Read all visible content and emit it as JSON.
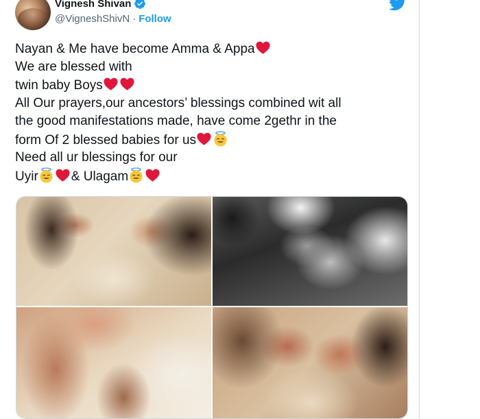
{
  "author": {
    "display_name": "Vignesh Shivan",
    "handle": "@VigneshShivN",
    "separator": "·",
    "follow_label": "Follow"
  },
  "tweet": {
    "lines": [
      [
        {
          "t": "Nayan & Me have become Amma & Appa"
        },
        {
          "e": "red-heart"
        }
      ],
      [
        {
          "t": "We are blessed with"
        }
      ],
      [
        {
          "t": "twin baby Boys"
        },
        {
          "e": "red-heart"
        },
        {
          "e": "red-heart"
        }
      ],
      [
        {
          "t": "All Our prayers,our ancestors’ blessings combined wit all"
        }
      ],
      [
        {
          "t": "the good manifestations made, have come 2gethr in the"
        }
      ],
      [
        {
          "t": "form Of 2 blessed babies for us"
        },
        {
          "e": "red-heart"
        },
        {
          "e": "smiling-face-with-halo"
        }
      ],
      [
        {
          "t": "Need all ur blessings for our"
        }
      ],
      [
        {
          "t": "Uyir"
        },
        {
          "e": "smiling-face-with-halo"
        },
        {
          "e": "red-heart"
        },
        {
          "t": "& Ulagam"
        },
        {
          "e": "smiling-face-with-halo"
        },
        {
          "e": "red-heart"
        }
      ]
    ]
  },
  "media": {
    "photos": [
      {
        "name": "photo-1",
        "description_icon": "baby-feet-kiss"
      },
      {
        "name": "photo-2",
        "description_icon": "baby-feet-bw"
      },
      {
        "name": "photo-3",
        "description_icon": "baby-feet-hands"
      },
      {
        "name": "photo-4",
        "description_icon": "baby-feet-kiss"
      }
    ]
  },
  "icons": {
    "verified": "verified-badge-icon",
    "brand": "twitter-bird-icon"
  },
  "colors": {
    "brand_blue": "#1d9bf0",
    "text_primary": "#0f1419",
    "text_secondary": "#536471",
    "heart_red": "#e0173a",
    "halo_yellow": "#f7c83a",
    "border": "#cfd9de"
  }
}
